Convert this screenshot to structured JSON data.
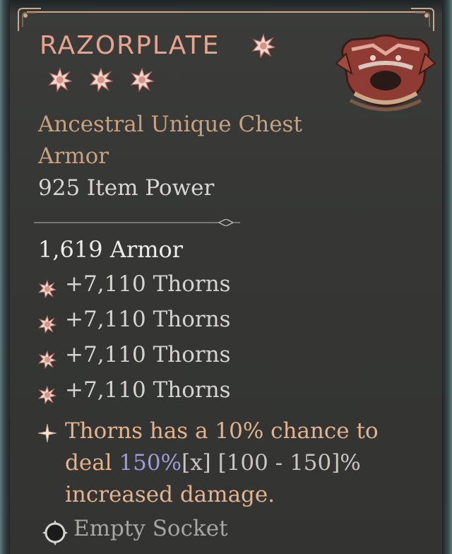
{
  "item": {
    "name": "RAZORPLATE",
    "rarity_type": "Ancestral Unique Chest Armor",
    "item_power": "925 Item Power",
    "base_stat": "1,619 Armor",
    "affixes": [
      "+7,110 Thorns",
      "+7,110 Thorns",
      "+7,110 Thorns",
      "+7,110 Thorns"
    ],
    "unique_power": {
      "part1": "Thorns has a 10% chance to deal ",
      "highlight": "150%",
      "part2": "[x] [100 - 150]%",
      "part3": " increased damage."
    },
    "socket": "Empty Socket",
    "star_count": 3
  },
  "colors": {
    "title": "#e5a48e",
    "subtitle": "#c8a17f",
    "unique_text": "#e2b38f",
    "unique_highlight": "#9e9cd8"
  },
  "icons": {
    "title_star": "unique-star-icon",
    "affix_bullet": "affix-star-icon",
    "unique_bullet": "unique-power-icon",
    "socket": "socket-icon",
    "item_art": "chest-armor-icon"
  }
}
